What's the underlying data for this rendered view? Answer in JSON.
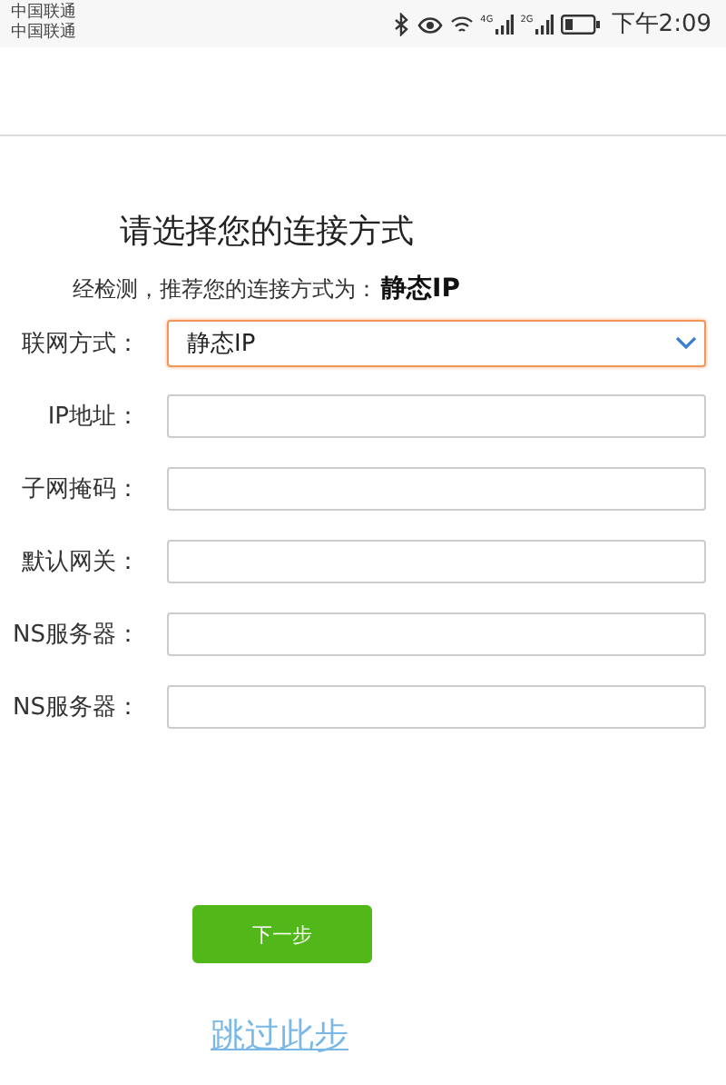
{
  "status_bar": {
    "carriers": [
      "中国联通",
      "中国联通"
    ],
    "network_badges": [
      "4G",
      "2G"
    ],
    "time": "下午2:09"
  },
  "title": "请选择您的连接方式",
  "recommendation": {
    "prefix": "经检测，推荐您的连接方式为：",
    "value": "静态IP"
  },
  "fields": [
    {
      "label": "联网方式：",
      "kind": "select",
      "value": "静态IP",
      "focused": true
    },
    {
      "label": "IP地址：",
      "kind": "input",
      "focused": false
    },
    {
      "label": "子网掩码：",
      "kind": "input",
      "focused": false
    },
    {
      "label": "默认网关：",
      "kind": "input",
      "focused": false
    },
    {
      "label": "NS服务器：",
      "kind": "input",
      "focused": false
    },
    {
      "label": "NS服务器：",
      "kind": "input",
      "focused": false
    }
  ],
  "next_button": "下一步",
  "skip_link": "跳过此步"
}
